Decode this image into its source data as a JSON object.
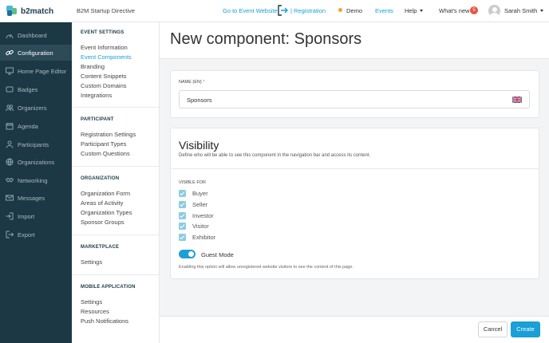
{
  "brand": {
    "name": "b2match"
  },
  "header": {
    "event_name": "B2M Startup Directive",
    "goto_event": "Go to Event Website",
    "registration": "| Registration",
    "demo": "Demo",
    "events": "Events",
    "help": "Help",
    "whats_new": "What's new",
    "notif_count": "5",
    "user_name": "Sarah Smith"
  },
  "sidebar": {
    "items": [
      {
        "label": "Dashboard",
        "icon": "dashboard-icon"
      },
      {
        "label": "Configuration",
        "icon": "link-icon"
      },
      {
        "label": "Home Page Editor",
        "icon": "monitor-icon"
      },
      {
        "label": "Badges",
        "icon": "badge-icon"
      },
      {
        "label": "Organizers",
        "icon": "people-icon"
      },
      {
        "label": "Agenda",
        "icon": "calendar-icon"
      },
      {
        "label": "Participants",
        "icon": "users-icon"
      },
      {
        "label": "Organizations",
        "icon": "globe-icon"
      },
      {
        "label": "Networking",
        "icon": "handshake-icon"
      },
      {
        "label": "Messages",
        "icon": "envelope-icon"
      },
      {
        "label": "Import",
        "icon": "import-icon"
      },
      {
        "label": "Export",
        "icon": "export-icon"
      }
    ],
    "active": "Configuration"
  },
  "menu": {
    "sections": [
      {
        "title": "EVENT SETTINGS",
        "items": [
          "Event Information",
          "Event Components",
          "Branding",
          "Content Snippets",
          "Custom Domains",
          "Integrations"
        ]
      },
      {
        "title": "PARTICIPANT",
        "items": [
          "Registration Settings",
          "Participant Types",
          "Custom Questions"
        ]
      },
      {
        "title": "ORGANIZATION",
        "items": [
          "Organization Form",
          "Areas of Activity",
          "Organization Types",
          "Sponsor Groups"
        ]
      },
      {
        "title": "MARKETPLACE",
        "items": [
          "Settings"
        ]
      },
      {
        "title": "MOBILE APPLICATION",
        "items": [
          "Settings",
          "Resources",
          "Push Notifications"
        ]
      }
    ],
    "active": "Event Components"
  },
  "page": {
    "title": "New component: Sponsors"
  },
  "form": {
    "name_label": "NAME (EN)",
    "required_mark": "*",
    "name_value": "Sponsors"
  },
  "visibility": {
    "title": "Visibility",
    "description": "Define who will be able to see this component in the navigation bar and access its content.",
    "visible_for_label": "VISIBLE FOR",
    "options": [
      {
        "label": "Buyer",
        "checked": true
      },
      {
        "label": "Seller",
        "checked": true
      },
      {
        "label": "Investor",
        "checked": true
      },
      {
        "label": "Visitor",
        "checked": true
      },
      {
        "label": "Exhibitor",
        "checked": true
      }
    ],
    "guest_mode_label": "Guest Mode",
    "guest_mode_on": true,
    "guest_mode_hint": "Enabling this option will allow unregistered website visitors to see the content of this page."
  },
  "actions": {
    "cancel": "Cancel",
    "create": "Create"
  },
  "colors": {
    "accent": "#1a9fd6",
    "sidebar_bg": "#1c3845",
    "notification": "#e8553e",
    "demo_dot": "#f5a623"
  }
}
